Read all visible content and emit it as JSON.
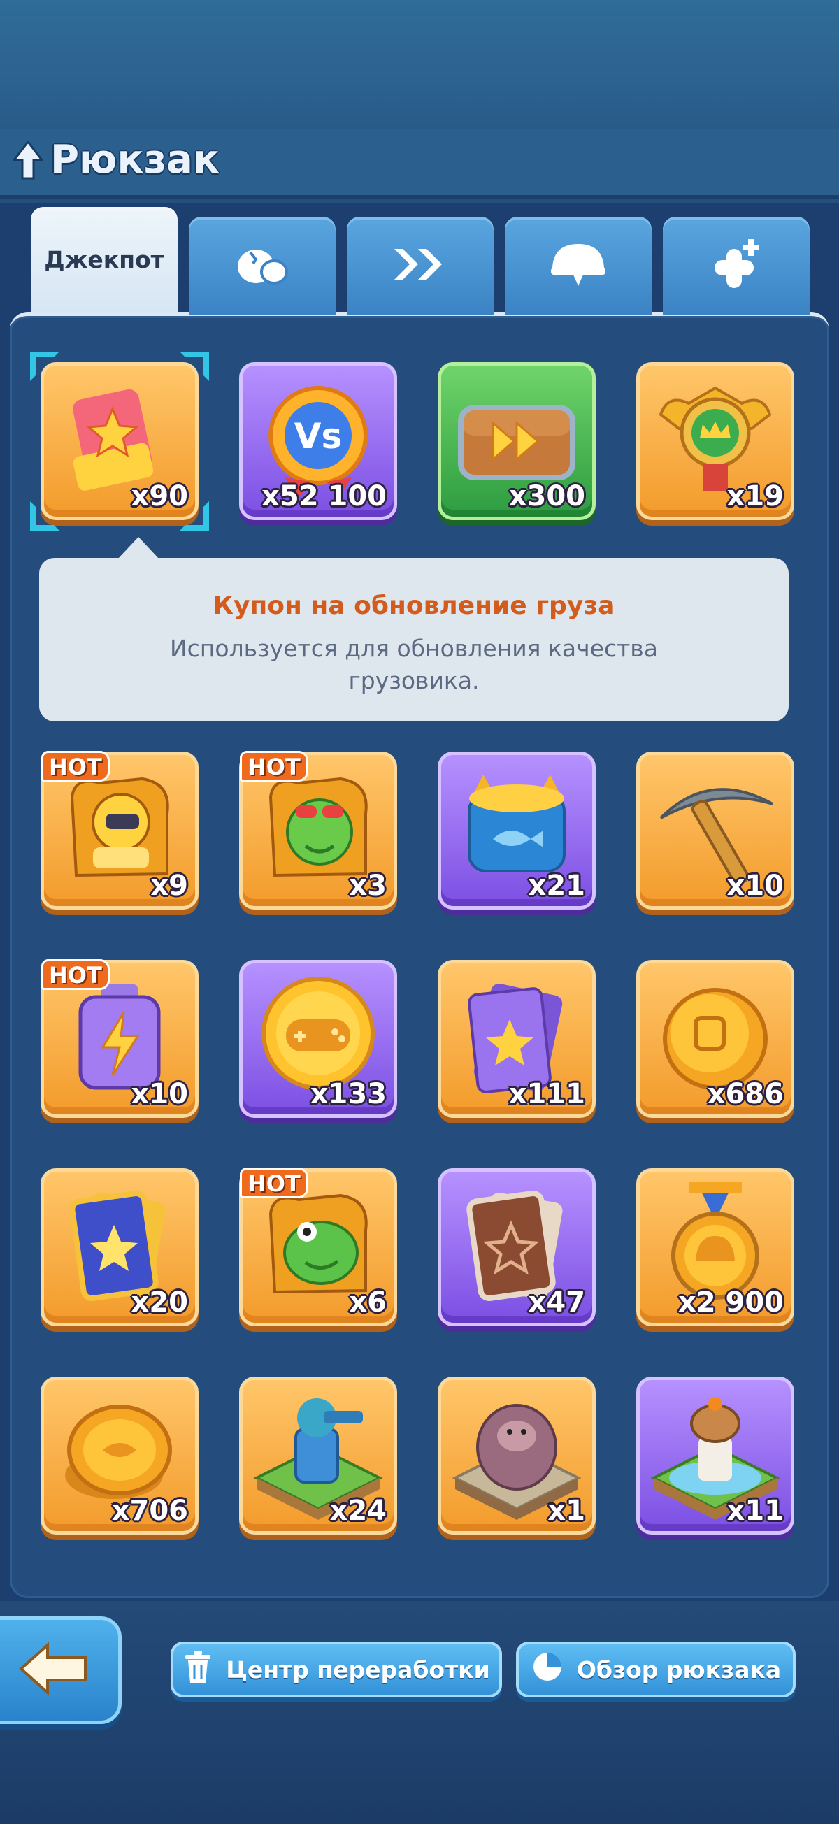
{
  "header": {
    "title": "Рюкзак"
  },
  "tabs": [
    {
      "label": "Джекпот",
      "icon": "jackpot-text",
      "active": true
    },
    {
      "label": "",
      "icon": "egg-icon",
      "active": false
    },
    {
      "label": "",
      "icon": "speed-up-icon",
      "active": false
    },
    {
      "label": "",
      "icon": "helmet-icon",
      "active": false
    },
    {
      "label": "",
      "icon": "bandage-plus-icon",
      "active": false
    }
  ],
  "items": [
    {
      "icon": "upgrade-coupon-ticket-icon",
      "count": "x90",
      "color": "orange",
      "hot": false,
      "selected": true
    },
    {
      "icon": "vs-medal-icon",
      "count": "x52 100",
      "color": "purple",
      "hot": false
    },
    {
      "icon": "speed-chest-icon",
      "count": "x300",
      "color": "green",
      "hot": false
    },
    {
      "icon": "crown-emblem-icon",
      "count": "x19",
      "color": "orange",
      "hot": false
    },
    {
      "icon": "yellow-robot-puzzle-icon",
      "count": "x9",
      "color": "orange",
      "hot": true
    },
    {
      "icon": "frog-puzzle-icon",
      "count": "x3",
      "color": "orange",
      "hot": true
    },
    {
      "icon": "cat-food-can-icon",
      "count": "x21",
      "color": "purple",
      "hot": false
    },
    {
      "icon": "pickaxe-icon",
      "count": "x10",
      "color": "orange",
      "hot": false
    },
    {
      "icon": "energy-battery-icon",
      "count": "x10",
      "color": "orange",
      "hot": true
    },
    {
      "icon": "gamepad-coin-icon",
      "count": "x133",
      "color": "purple",
      "hot": false
    },
    {
      "icon": "purple-star-cards-icon",
      "count": "x111",
      "color": "orange",
      "hot": false
    },
    {
      "icon": "gold-token-icon",
      "count": "x686",
      "color": "orange",
      "hot": false
    },
    {
      "icon": "blue-star-card-icon",
      "count": "x20",
      "color": "orange",
      "hot": false
    },
    {
      "icon": "green-frog-puzzle-icon",
      "count": "x6",
      "color": "orange",
      "hot": true
    },
    {
      "icon": "brown-star-cards-icon",
      "count": "x47",
      "color": "purple",
      "hot": false
    },
    {
      "icon": "helmet-medal-icon",
      "count": "x2 900",
      "color": "orange",
      "hot": false
    },
    {
      "icon": "gold-coins-icon",
      "count": "x706",
      "color": "orange",
      "hot": false
    },
    {
      "icon": "blue-turret-icon",
      "count": "x24",
      "color": "orange",
      "hot": false
    },
    {
      "icon": "gorilla-statue-icon",
      "count": "x1",
      "color": "orange",
      "hot": false
    },
    {
      "icon": "capybara-fountain-icon",
      "count": "x11",
      "color": "purple",
      "hot": false
    }
  ],
  "hot_label": "HOT",
  "tooltip": {
    "title": "Купон на обновление груза",
    "description": "Используется для обновления качества грузовика."
  },
  "footer": {
    "back_icon": "back-arrow-icon",
    "recycle_label": "Центр переработки",
    "recycle_icon": "trash-can-icon",
    "overview_label": "Обзор рюкзака",
    "overview_icon": "pie-chart-icon"
  },
  "colors": {
    "orange_tile": "#f6a33a",
    "purple_tile": "#8d5cf0",
    "green_tile": "#3fae4c",
    "tooltip_title": "#d35c1c",
    "selection": "#33c5e6"
  }
}
